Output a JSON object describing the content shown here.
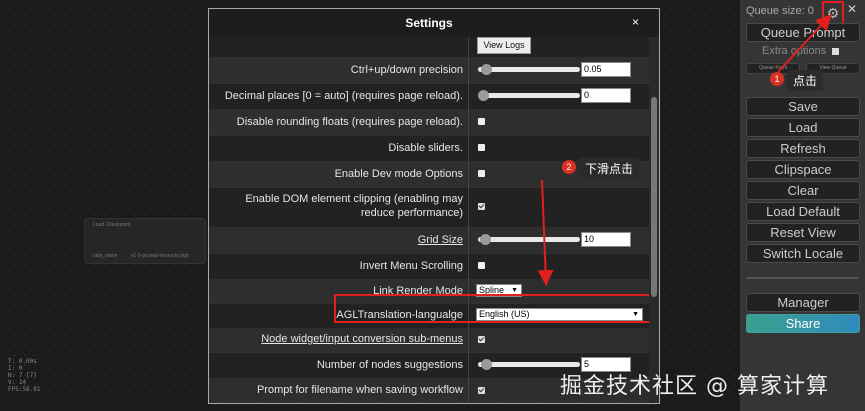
{
  "canvas": {
    "node": {
      "title": "Load Checkpoint",
      "left_text": "ckpt_name",
      "right_text": "v1-5-pruned-emaonly.ckpt"
    },
    "stats": [
      "T: 0.00s",
      "I: 0",
      "N: 7 [7]",
      "V: 14",
      "FPS:58.81"
    ],
    "watermark": "掘金技术社区 @ 算家计算"
  },
  "menu": {
    "queue_size": "Queue size: 0",
    "gear_icon": "gear-icon",
    "close_label": "✕",
    "queue_prompt": "Queue Prompt",
    "extra_options": "Extra options",
    "queue_front": "Queue Front",
    "view_queue": "View Queue",
    "buttons": [
      "Save",
      "Load",
      "Refresh",
      "Clipspace",
      "Clear",
      "Load Default",
      "Reset View",
      "Switch Locale"
    ],
    "manager": "Manager",
    "share": "Share"
  },
  "annotations": {
    "step1_num": "1",
    "step1_text": "点击",
    "step2_num": "2",
    "step2_text": "下滑点击",
    "color": "#e02020"
  },
  "dialog": {
    "title": "Settings",
    "close": "×",
    "view_logs": "View Logs",
    "rows": {
      "ctrl_precision": {
        "label": "Ctrl+up/down precision",
        "value": "0.05"
      },
      "decimal_places": {
        "label": "Decimal places [0 = auto] (requires page reload).",
        "value": "0"
      },
      "disable_rounding": {
        "label": "Disable rounding floats (requires page reload)."
      },
      "disable_sliders": {
        "label": "Disable sliders."
      },
      "dev_mode": {
        "label": "Enable Dev mode Options"
      },
      "dom_clip_1": {
        "label": "Enable DOM element clipping (enabling may"
      },
      "dom_clip_2": {
        "label": "reduce performance)"
      },
      "grid_size": {
        "label": "Grid Size",
        "value": "10"
      },
      "invert_scroll": {
        "label": "Invert Menu Scrolling"
      },
      "link_render": {
        "label": "Link Render Mode",
        "value": "Spline"
      },
      "agl_language": {
        "label": "AGLTranslation-langualge",
        "value": "English (US)"
      },
      "widget_conversion": {
        "label": "Node widget/input conversion sub-menus"
      },
      "node_suggestions": {
        "label": "Number of nodes suggestions",
        "value": "5"
      },
      "prompt_filename": {
        "label": "Prompt for filename when saving workflow"
      }
    }
  }
}
